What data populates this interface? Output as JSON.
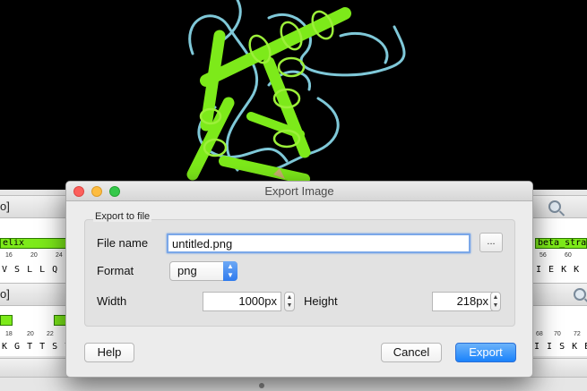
{
  "dialog": {
    "title": "Export Image",
    "group_label": "Export to file",
    "file_name_label": "File name",
    "file_name_value": "untitled.png",
    "browse_label": "...",
    "format_label": "Format",
    "format_value": "png",
    "width_label": "Width",
    "width_value": "1000px",
    "height_label": "Height",
    "height_value": "218px",
    "help_label": "Help",
    "cancel_label": "Cancel",
    "export_label": "Export"
  },
  "background": {
    "panel1_label": "o]",
    "panel2_label": "o]",
    "track_left_label": "elix",
    "track_right_label": "beta_stra",
    "seq_row1_left": "V S L L Q",
    "seq_row1_right": "I E K K",
    "seq_row2_left": "K G T T S Y",
    "seq_row2_right": "I I S K E",
    "ruler1_left": [
      "16",
      "20",
      "24"
    ],
    "ruler1_right": [
      "56",
      "60"
    ],
    "ruler2_left": [
      "18",
      "20",
      "22"
    ],
    "ruler2_right": [
      "68",
      "70",
      "72"
    ]
  },
  "colors": {
    "helix": "#7dea1a",
    "coil": "#7fc8d8",
    "default_button": "#1a82fb",
    "viewer_background": "#000000"
  }
}
